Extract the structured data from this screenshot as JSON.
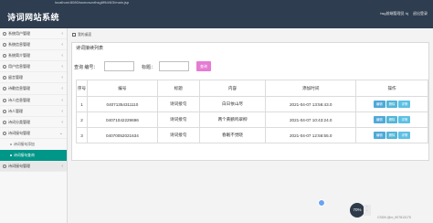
{
  "header": {
    "title": "诗词网站系统",
    "address": "localhost:8080/ssmcwzxthsg6f9/#6/3/main.jsp",
    "user": "hsg前端管理员 hj",
    "logout": "退出登录"
  },
  "sidebar": {
    "items": [
      {
        "label": "系统用户管理"
      },
      {
        "label": "系统信息管理"
      },
      {
        "label": "系统简介管理"
      },
      {
        "label": "用户信息管理"
      },
      {
        "label": "留言管理"
      },
      {
        "label": "诗歌信息管理"
      },
      {
        "label": "诗人信息管理"
      },
      {
        "label": "诗人管理"
      },
      {
        "label": "诗词分类管理"
      },
      {
        "label": "诗词接句管理"
      }
    ],
    "subitems": [
      {
        "label": "诗词接句添加"
      },
      {
        "label": "诗词接句查询"
      }
    ],
    "last_item": {
      "label": "诗词接句管理"
    }
  },
  "breadcrumb": "我的桌面",
  "panel": {
    "title": "诗词接续列表",
    "search_label_id": "查询 编号：",
    "search_label_title": "标题：",
    "search_button": "查询"
  },
  "table": {
    "headers": [
      "序号",
      "编号",
      "标题",
      "内容",
      "添加时间",
      "操作"
    ],
    "rows": [
      {
        "idx": "1",
        "code": "04071354311110",
        "title": "诗词接句",
        "content": "白日依山尽",
        "time": "2021-04-07 13:56:43.0"
      },
      {
        "idx": "2",
        "code": "04071042229696",
        "title": "诗词接句",
        "content": "两个黄鹂鸣翠柳",
        "time": "2021-04-07 10:43:24.0"
      },
      {
        "idx": "3",
        "code": "04070052021634",
        "title": "诗词接句",
        "content": "春眠不觉晓",
        "time": "2021-04-07 12:56:55.0"
      }
    ],
    "actions": [
      "编辑",
      "删除",
      "详情"
    ]
  },
  "overlay": {
    "perf_value": "70",
    "perf_unit": "%",
    "watermark": "CSDN @m_907813175"
  },
  "colors": {
    "topbar": "#2e3d4f",
    "active_menu": "#009688",
    "search_button": "#e67bd3",
    "action_button": "#4fa9d9"
  }
}
